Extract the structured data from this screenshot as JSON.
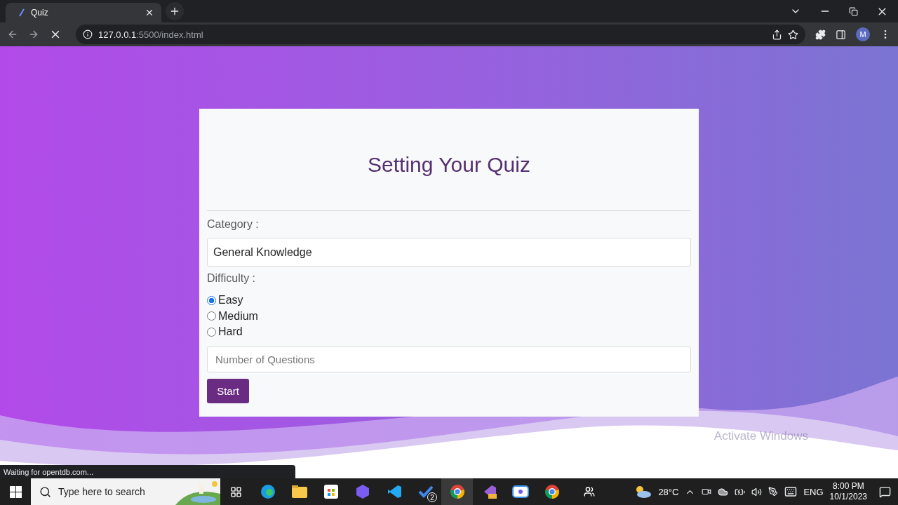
{
  "browser": {
    "tab_title": "Quiz",
    "address_host": "127.0.0.1",
    "address_rest": ":5500/index.html",
    "profile_initial": "M",
    "status": "Waiting for opentdb.com..."
  },
  "quiz": {
    "title": "Setting Your Quiz",
    "category_label": "Category :",
    "category_value": "General Knowledge",
    "difficulty_label": "Difficulty :",
    "options": [
      {
        "label": "Easy",
        "selected": true
      },
      {
        "label": "Medium",
        "selected": false
      },
      {
        "label": "Hard",
        "selected": false
      }
    ],
    "questions_placeholder": "Number of Questions",
    "start_button": "Start"
  },
  "activation_notice": "Activate Windows",
  "taskbar": {
    "search_placeholder": "Type here to search",
    "todo_badge": "2",
    "temperature": "28°C",
    "language": "ENG",
    "time": "8:00 PM",
    "date": "10/1/2023"
  }
}
